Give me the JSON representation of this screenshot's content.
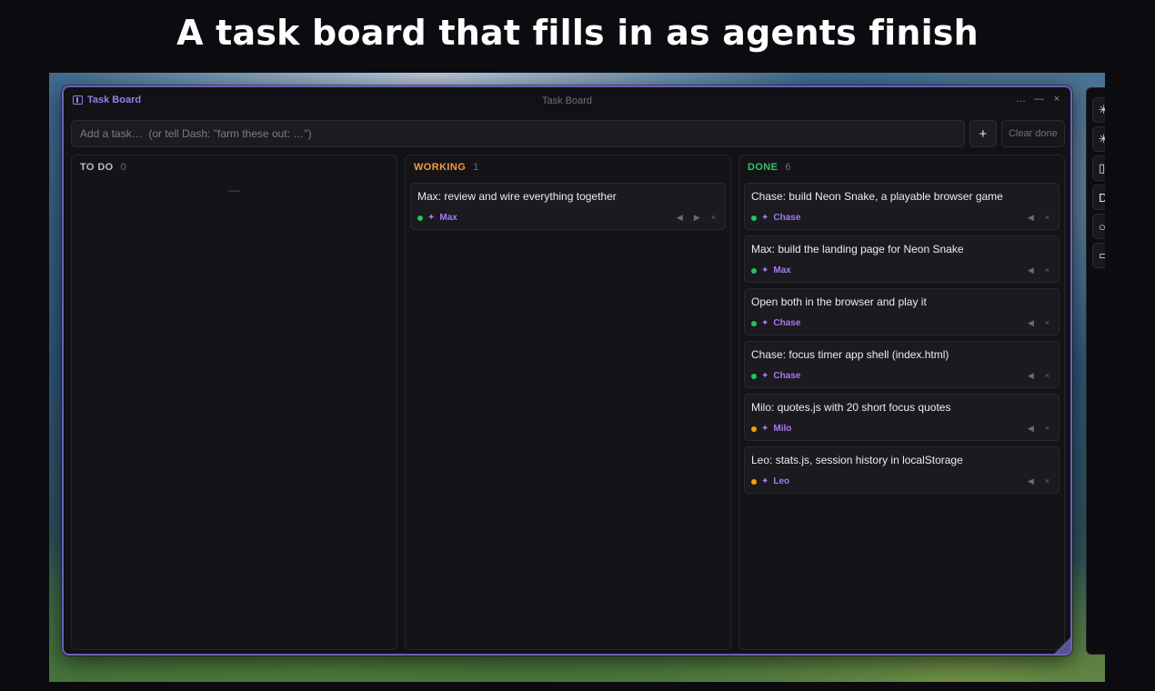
{
  "headline": "A task board that fills in as agents finish",
  "window": {
    "app_name": "Task Board",
    "title": "Task Board",
    "controls": {
      "more": "…",
      "minimize": "—",
      "close": "×"
    }
  },
  "add_row": {
    "placeholder": "Add a task…  (or tell Dash: \"farm these out: …\")",
    "add_label": "+",
    "clear_label": "Clear done"
  },
  "columns": [
    {
      "title": "TO DO",
      "count": "0",
      "color": "#b9bcc8",
      "empty": "—",
      "cards": []
    },
    {
      "title": "WORKING",
      "count": "1",
      "color": "#f39a3c",
      "cards": [
        {
          "text": "Max: review and wire everything together",
          "agent": "Max",
          "dot": "#22c55e"
        }
      ]
    },
    {
      "title": "DONE",
      "count": "6",
      "color": "#34c36b",
      "cards": [
        {
          "text": "Chase: build Neon Snake, a playable browser game",
          "agent": "Chase",
          "dot": "#22c55e"
        },
        {
          "text": "Max: build the landing page for Neon Snake",
          "agent": "Max",
          "dot": "#22c55e"
        },
        {
          "text": "Open both in the browser and play it",
          "agent": "Chase",
          "dot": "#22c55e"
        },
        {
          "text": "Chase: focus timer app shell (index.html)",
          "agent": "Chase",
          "dot": "#22c55e"
        },
        {
          "text": "Milo: quotes.js with 20 short focus quotes",
          "agent": "Milo",
          "dot": "#f59e0b"
        },
        {
          "text": "Leo: stats.js, session history in localStorage",
          "agent": "Leo",
          "dot": "#f59e0b"
        }
      ]
    }
  ],
  "card_icons": {
    "spark": "✦",
    "left": "◀",
    "right": "▶",
    "remove": "×"
  },
  "colors": {
    "accent": "#8b84e6",
    "agent": "#a678f0",
    "window_border": "#6a63b8"
  }
}
